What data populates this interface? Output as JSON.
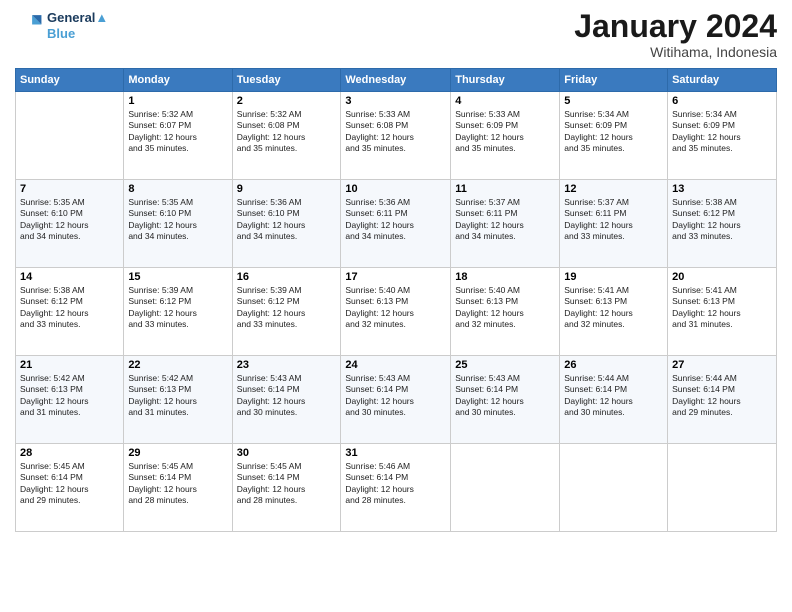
{
  "header": {
    "logo_line1": "General",
    "logo_line2": "Blue",
    "month": "January 2024",
    "location": "Witihama, Indonesia"
  },
  "weekdays": [
    "Sunday",
    "Monday",
    "Tuesday",
    "Wednesday",
    "Thursday",
    "Friday",
    "Saturday"
  ],
  "weeks": [
    [
      {
        "day": "",
        "info": ""
      },
      {
        "day": "1",
        "info": "Sunrise: 5:32 AM\nSunset: 6:07 PM\nDaylight: 12 hours\nand 35 minutes."
      },
      {
        "day": "2",
        "info": "Sunrise: 5:32 AM\nSunset: 6:08 PM\nDaylight: 12 hours\nand 35 minutes."
      },
      {
        "day": "3",
        "info": "Sunrise: 5:33 AM\nSunset: 6:08 PM\nDaylight: 12 hours\nand 35 minutes."
      },
      {
        "day": "4",
        "info": "Sunrise: 5:33 AM\nSunset: 6:09 PM\nDaylight: 12 hours\nand 35 minutes."
      },
      {
        "day": "5",
        "info": "Sunrise: 5:34 AM\nSunset: 6:09 PM\nDaylight: 12 hours\nand 35 minutes."
      },
      {
        "day": "6",
        "info": "Sunrise: 5:34 AM\nSunset: 6:09 PM\nDaylight: 12 hours\nand 35 minutes."
      }
    ],
    [
      {
        "day": "7",
        "info": "Sunrise: 5:35 AM\nSunset: 6:10 PM\nDaylight: 12 hours\nand 34 minutes."
      },
      {
        "day": "8",
        "info": "Sunrise: 5:35 AM\nSunset: 6:10 PM\nDaylight: 12 hours\nand 34 minutes."
      },
      {
        "day": "9",
        "info": "Sunrise: 5:36 AM\nSunset: 6:10 PM\nDaylight: 12 hours\nand 34 minutes."
      },
      {
        "day": "10",
        "info": "Sunrise: 5:36 AM\nSunset: 6:11 PM\nDaylight: 12 hours\nand 34 minutes."
      },
      {
        "day": "11",
        "info": "Sunrise: 5:37 AM\nSunset: 6:11 PM\nDaylight: 12 hours\nand 34 minutes."
      },
      {
        "day": "12",
        "info": "Sunrise: 5:37 AM\nSunset: 6:11 PM\nDaylight: 12 hours\nand 33 minutes."
      },
      {
        "day": "13",
        "info": "Sunrise: 5:38 AM\nSunset: 6:12 PM\nDaylight: 12 hours\nand 33 minutes."
      }
    ],
    [
      {
        "day": "14",
        "info": "Sunrise: 5:38 AM\nSunset: 6:12 PM\nDaylight: 12 hours\nand 33 minutes."
      },
      {
        "day": "15",
        "info": "Sunrise: 5:39 AM\nSunset: 6:12 PM\nDaylight: 12 hours\nand 33 minutes."
      },
      {
        "day": "16",
        "info": "Sunrise: 5:39 AM\nSunset: 6:12 PM\nDaylight: 12 hours\nand 33 minutes."
      },
      {
        "day": "17",
        "info": "Sunrise: 5:40 AM\nSunset: 6:13 PM\nDaylight: 12 hours\nand 32 minutes."
      },
      {
        "day": "18",
        "info": "Sunrise: 5:40 AM\nSunset: 6:13 PM\nDaylight: 12 hours\nand 32 minutes."
      },
      {
        "day": "19",
        "info": "Sunrise: 5:41 AM\nSunset: 6:13 PM\nDaylight: 12 hours\nand 32 minutes."
      },
      {
        "day": "20",
        "info": "Sunrise: 5:41 AM\nSunset: 6:13 PM\nDaylight: 12 hours\nand 31 minutes."
      }
    ],
    [
      {
        "day": "21",
        "info": "Sunrise: 5:42 AM\nSunset: 6:13 PM\nDaylight: 12 hours\nand 31 minutes."
      },
      {
        "day": "22",
        "info": "Sunrise: 5:42 AM\nSunset: 6:13 PM\nDaylight: 12 hours\nand 31 minutes."
      },
      {
        "day": "23",
        "info": "Sunrise: 5:43 AM\nSunset: 6:14 PM\nDaylight: 12 hours\nand 30 minutes."
      },
      {
        "day": "24",
        "info": "Sunrise: 5:43 AM\nSunset: 6:14 PM\nDaylight: 12 hours\nand 30 minutes."
      },
      {
        "day": "25",
        "info": "Sunrise: 5:43 AM\nSunset: 6:14 PM\nDaylight: 12 hours\nand 30 minutes."
      },
      {
        "day": "26",
        "info": "Sunrise: 5:44 AM\nSunset: 6:14 PM\nDaylight: 12 hours\nand 30 minutes."
      },
      {
        "day": "27",
        "info": "Sunrise: 5:44 AM\nSunset: 6:14 PM\nDaylight: 12 hours\nand 29 minutes."
      }
    ],
    [
      {
        "day": "28",
        "info": "Sunrise: 5:45 AM\nSunset: 6:14 PM\nDaylight: 12 hours\nand 29 minutes."
      },
      {
        "day": "29",
        "info": "Sunrise: 5:45 AM\nSunset: 6:14 PM\nDaylight: 12 hours\nand 28 minutes."
      },
      {
        "day": "30",
        "info": "Sunrise: 5:45 AM\nSunset: 6:14 PM\nDaylight: 12 hours\nand 28 minutes."
      },
      {
        "day": "31",
        "info": "Sunrise: 5:46 AM\nSunset: 6:14 PM\nDaylight: 12 hours\nand 28 minutes."
      },
      {
        "day": "",
        "info": ""
      },
      {
        "day": "",
        "info": ""
      },
      {
        "day": "",
        "info": ""
      }
    ]
  ]
}
